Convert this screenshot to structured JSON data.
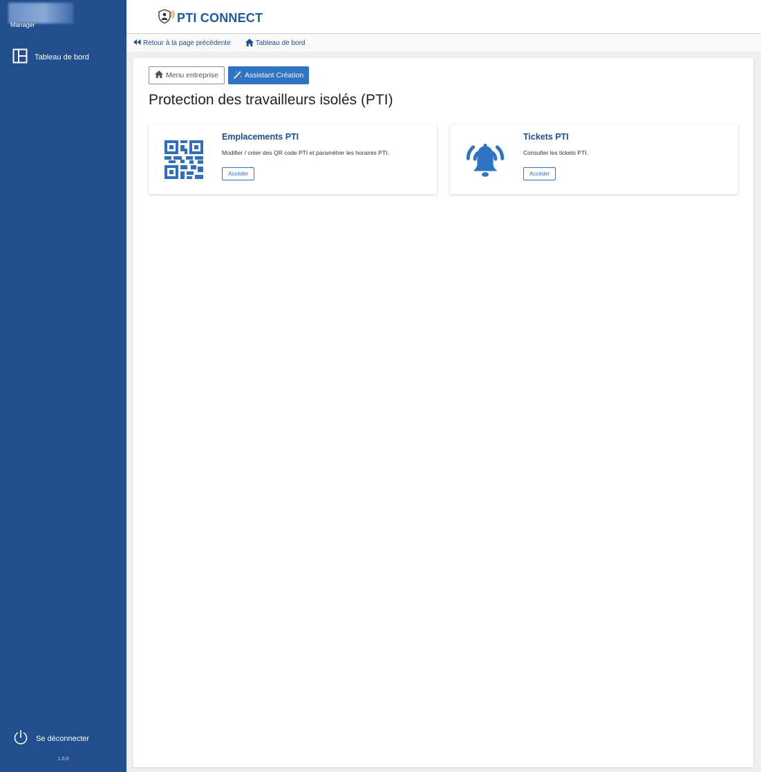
{
  "sidebar": {
    "user_role": "Manager",
    "nav_items": [
      {
        "label": "Tableau de bord",
        "icon": "dashboard-layout-icon"
      }
    ],
    "logout_label": "Se déconnecter",
    "version": "1.0.0"
  },
  "header": {
    "brand_name": "PTI CONNECT",
    "brand_icon": "pti-shield-logo-icon",
    "brand_color": "#1d5a9f"
  },
  "breadcrumb": {
    "back_label": "Retour à la page précédente",
    "home_label": "Tableau de bord"
  },
  "toolbar": {
    "menu_label": "Menu entreprise",
    "assistant_label": "Assistant Création"
  },
  "page": {
    "title": "Protection des travailleurs isolés (PTI)"
  },
  "cards": [
    {
      "title": "Emplacements PTI",
      "description": "Modifier / créer des QR code PTI et paramétrer les horaires PTI.",
      "button_label": "Accéder",
      "icon": "qr-code-icon"
    },
    {
      "title": "Tickets PTI",
      "description": "Consulter les tickets PTI.",
      "button_label": "Accéder",
      "icon": "ringing-bell-icon"
    }
  ],
  "colors": {
    "sidebar_bg": "#224e8e",
    "accent": "#2f73c4",
    "title_blue": "#1d4f8f"
  }
}
